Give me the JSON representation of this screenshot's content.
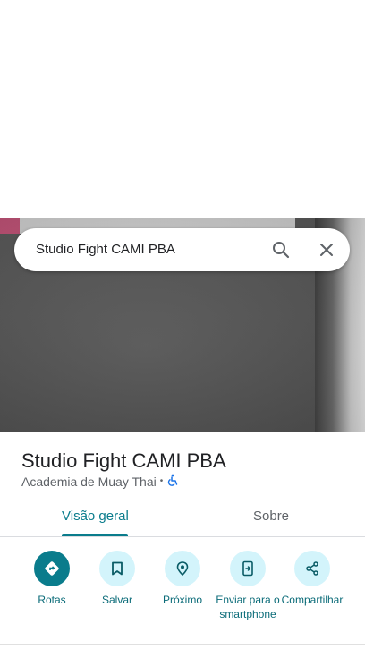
{
  "search": {
    "query": "Studio Fight CAMI PBA"
  },
  "place": {
    "name": "Studio Fight CAMI PBA",
    "category": "Academia de Muay Thai",
    "separator": "•",
    "accessibility_icon": "wheelchair-icon"
  },
  "tabs": [
    {
      "label": "Visão geral",
      "active": true
    },
    {
      "label": "Sobre",
      "active": false
    }
  ],
  "actions": [
    {
      "label": "Rotas",
      "icon": "directions-icon"
    },
    {
      "label": "Salvar",
      "icon": "bookmark-icon"
    },
    {
      "label": "Próximo",
      "icon": "nearby-icon"
    },
    {
      "label": "Enviar para o smartphone",
      "icon": "send-to-phone-icon"
    },
    {
      "label": "Compartilhar",
      "icon": "share-icon"
    }
  ],
  "colors": {
    "accent": "#0a7c8c",
    "action_bg": "#d3f4fb",
    "accessibility": "#1a73e8"
  }
}
